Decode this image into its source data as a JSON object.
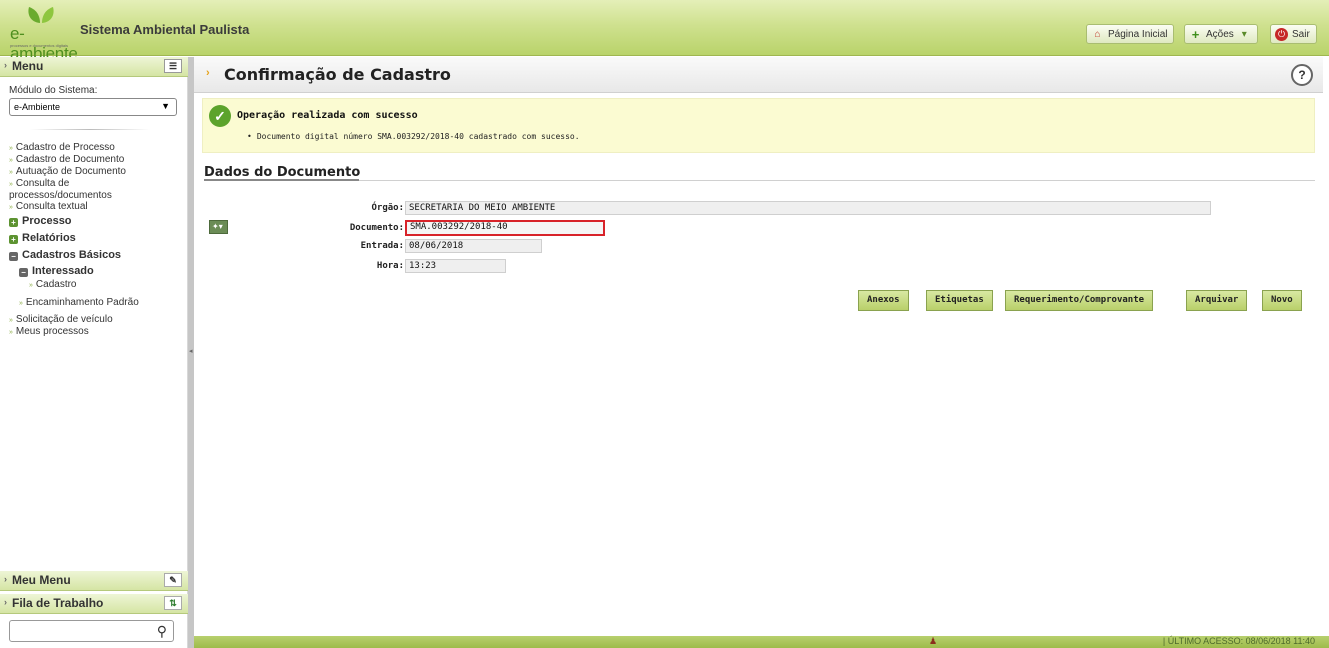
{
  "header": {
    "logo_text": "e-ambiente",
    "logo_sub": "processos e documentos digitais",
    "app_title": "Sistema Ambiental Paulista",
    "buttons": {
      "home": "Página Inicial",
      "actions": "Ações",
      "exit": "Sair"
    }
  },
  "sidebar": {
    "menu_title": "Menu",
    "modulo_label": "Módulo do Sistema:",
    "modulo_value": "e-Ambiente",
    "items": [
      "Cadastro de Processo",
      "Cadastro de Documento",
      "Autuação de Documento",
      "Consulta de",
      "processos/documentos",
      "Consulta textual"
    ],
    "groups": {
      "processo": "Processo",
      "relatorios": "Relatórios",
      "cadastros_basicos": "Cadastros Básicos",
      "interessado": "Interessado"
    },
    "sub_items": {
      "cadastro": "Cadastro",
      "encaminhamento": "Encaminhamento Padrão"
    },
    "items2": [
      "Solicitação de veículo",
      "Meus processos"
    ],
    "meu_menu": "Meu Menu",
    "fila": "Fila de Trabalho"
  },
  "main": {
    "page_title": "Confirmação de Cadastro",
    "help": "?",
    "message_title": "Operação realizada com sucesso",
    "message_detail": "Documento digital número SMA.003292/2018-40 cadastrado com sucesso.",
    "section_title": "Dados do Documento",
    "fields": {
      "orgao_label": "Órgão:",
      "orgao_value": "SECRETARIA DO MEIO AMBIENTE",
      "documento_label": "Documento:",
      "documento_value": "SMA.003292/2018-40",
      "entrada_label": "Entrada:",
      "entrada_value": "08/06/2018",
      "hora_label": "Hora:",
      "hora_value": "13:23"
    },
    "actions": [
      "Anexos",
      "Etiquetas",
      "Requerimento/Comprovante",
      "Arquivar",
      "Novo"
    ]
  },
  "footer": {
    "last_access": "|   ÚLTIMO ACESSO: 08/06/2018 11:40"
  },
  "colors": {
    "brand_green": "#5ca32c",
    "header_green": "#cfe18f",
    "highlight_red": "#d8232a"
  }
}
